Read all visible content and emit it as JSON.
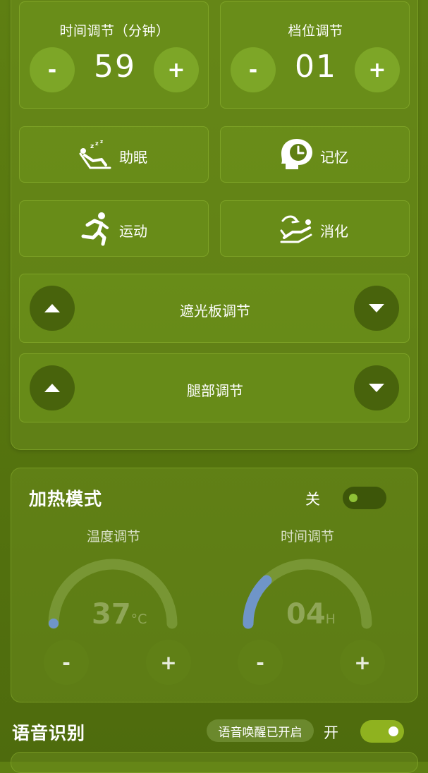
{
  "time_adjust": {
    "title": "时间调节（分钟）",
    "value": "59",
    "minus": "-",
    "plus": "+"
  },
  "gear_adjust": {
    "title": "档位调节",
    "value": "01",
    "minus": "-",
    "plus": "+"
  },
  "modes": [
    {
      "label": "助眠",
      "icon": "sleep-recline-icon"
    },
    {
      "label": "记忆",
      "icon": "head-clock-icon"
    },
    {
      "label": "运动",
      "icon": "running-person-icon"
    },
    {
      "label": "消化",
      "icon": "digestion-recline-icon"
    }
  ],
  "sunshade": {
    "label": "遮光板调节"
  },
  "leg": {
    "label": "腿部调节"
  },
  "heating": {
    "title": "加热模式",
    "switch_label": "关",
    "switch_on": false,
    "temp": {
      "title": "温度调节",
      "value": "37",
      "unit": "°C",
      "minus": "-",
      "plus": "+"
    },
    "time": {
      "title": "时间调节",
      "value": "04",
      "unit": "H",
      "minus": "-",
      "plus": "+"
    }
  },
  "voice": {
    "title": "语音识别",
    "wake_badge": "语音唤醒已开启",
    "switch_label": "开",
    "switch_on": true
  },
  "colors": {
    "accent_blue": "#6f95c8",
    "button_green": "#7ea828"
  }
}
